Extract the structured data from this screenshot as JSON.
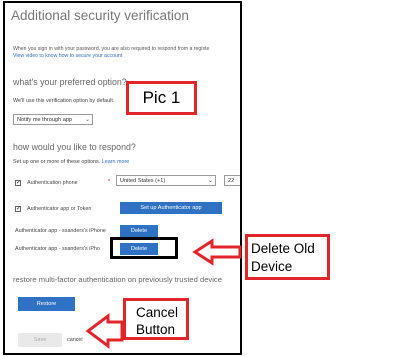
{
  "dialog": {
    "title": "Additional security verification",
    "intro_line1": "When you sign in with your password, you are also required to respond from a registe",
    "intro_link": "View video to know how to secure your account",
    "preferred": {
      "heading": "what's your preferred option?",
      "description": "We'll use this verification option by default.",
      "selected": "Notify me through app"
    },
    "respond": {
      "heading": "how would you like to respond?",
      "description": "Set up one or more of these options.",
      "learn_more": "Learn more",
      "auth_phone_label": "Authentication phone",
      "required_mark": "*",
      "country_value": "United States (+1)",
      "phone_partial": "22",
      "auth_app_label": "Authenticator app or Token",
      "setup_app_button": "Set up Authenticator app",
      "device1_label": "Authenticator app - ssanders's iPhone",
      "device2_label": "Authenticator app - ssanders's iPho",
      "delete_label": "Delete"
    },
    "restore": {
      "heading": "restore multi-factor authentication on previously trusted device",
      "button": "Restore"
    },
    "footer": {
      "save": "Save",
      "cancel": "cancel"
    }
  },
  "annotations": {
    "pic_label": "Pic 1",
    "delete_old_line1": "Delete Old",
    "delete_old_line2": "Device",
    "cancel_line1": "Cancel",
    "cancel_line2": "Button"
  },
  "colors": {
    "annotation_red": "#e0262a",
    "button_blue": "#2f72c4",
    "link_blue": "#2a6fc1"
  }
}
